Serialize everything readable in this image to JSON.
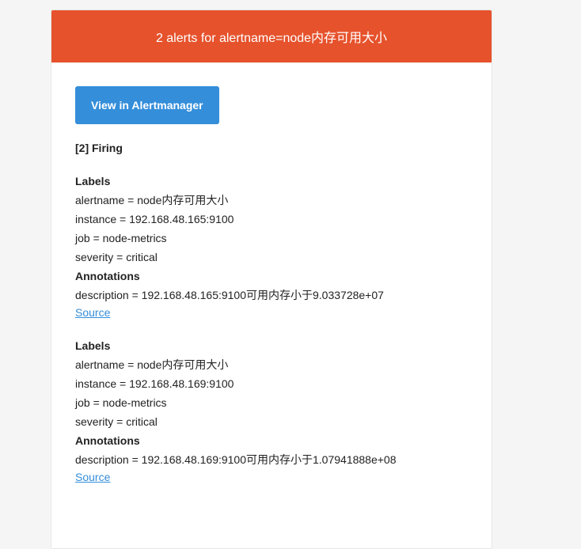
{
  "header": {
    "title": "2 alerts for alertname=node内存可用大小"
  },
  "button": {
    "label": "View in Alertmanager"
  },
  "status": {
    "firing": "[2] Firing"
  },
  "alerts": [
    {
      "labels_heading": "Labels",
      "labels": [
        "alertname = node内存可用大小",
        "instance = 192.168.48.165:9100",
        "job = node-metrics",
        "severity = critical"
      ],
      "annotations_heading": "Annotations",
      "annotations": [
        "description = 192.168.48.165:9100可用内存小于9.033728e+07"
      ],
      "source_label": "Source"
    },
    {
      "labels_heading": "Labels",
      "labels": [
        "alertname = node内存可用大小",
        "instance = 192.168.48.169:9100",
        "job = node-metrics",
        "severity = critical"
      ],
      "annotations_heading": "Annotations",
      "annotations": [
        "description = 192.168.48.169:9100可用内存小于1.07941888e+08"
      ],
      "source_label": "Source"
    }
  ],
  "colors": {
    "header_bg": "#e6522c",
    "button_bg": "#348eda",
    "link": "#348eda",
    "page_bg": "#f5f5f5"
  }
}
